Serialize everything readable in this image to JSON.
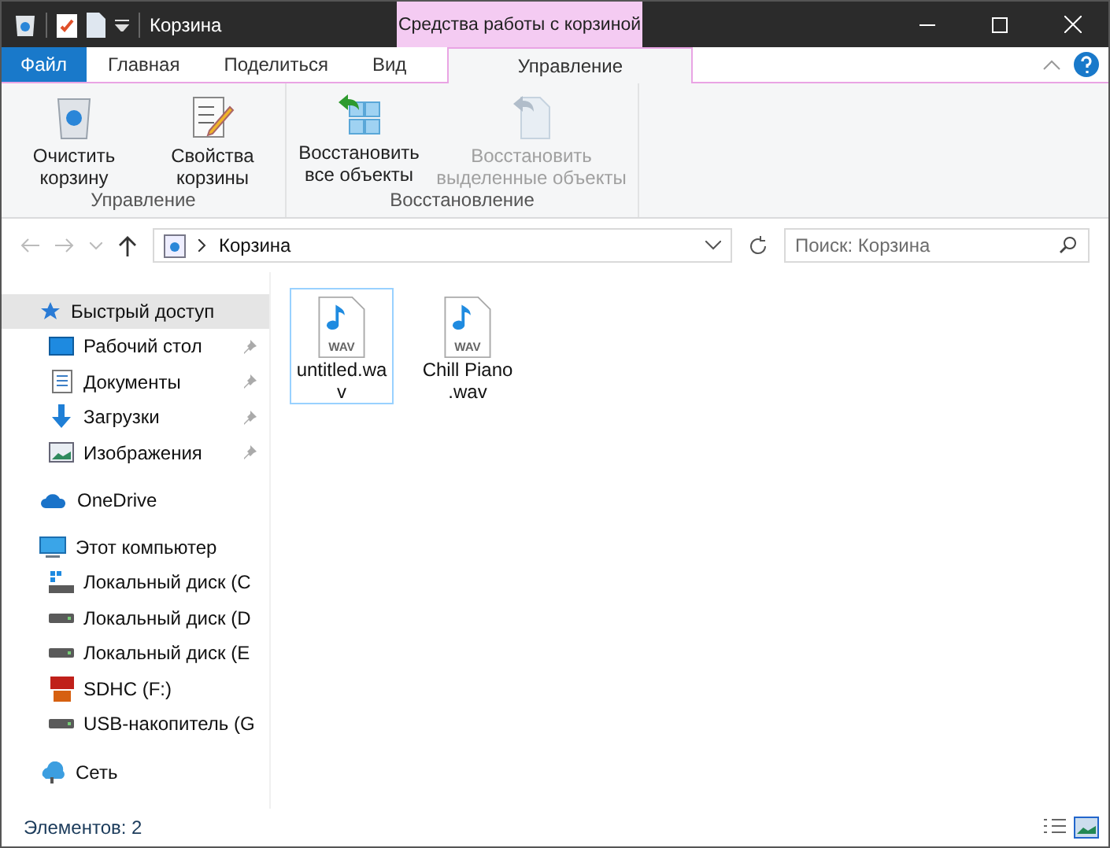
{
  "window": {
    "title": "Корзина",
    "context_group": "Средства работы с корзиной"
  },
  "tabs": [
    {
      "label": "Файл",
      "selected": false,
      "kind": "file"
    },
    {
      "label": "Главная",
      "selected": false,
      "kind": "normal"
    },
    {
      "label": "Поделиться",
      "selected": false,
      "kind": "normal"
    },
    {
      "label": "Вид",
      "selected": false,
      "kind": "normal"
    },
    {
      "label": "Управление",
      "selected": true,
      "kind": "context"
    }
  ],
  "ribbon": {
    "groups": [
      {
        "label": "Управление",
        "buttons": [
          {
            "label": "Очистить корзину",
            "disabled": false
          },
          {
            "label": "Свойства корзины",
            "disabled": false
          }
        ]
      },
      {
        "label": "Восстановление",
        "buttons": [
          {
            "label": "Восстановить все объекты",
            "disabled": false
          },
          {
            "label": "Восстановить выделенные объекты",
            "disabled": true
          }
        ]
      }
    ]
  },
  "address": {
    "path": "Корзина",
    "search_placeholder": "Поиск: Корзина"
  },
  "sidebar": {
    "items": [
      {
        "label": "Быстрый доступ",
        "selected": true,
        "children": [
          {
            "label": "Рабочий стол",
            "pinned": true
          },
          {
            "label": "Документы",
            "pinned": true
          },
          {
            "label": "Загрузки",
            "pinned": true
          },
          {
            "label": "Изображения",
            "pinned": true
          }
        ]
      },
      {
        "label": "OneDrive",
        "selected": false
      },
      {
        "label": "Этот компьютер",
        "selected": false,
        "children": [
          {
            "label": "Локальный диск (C",
            "pinned": false
          },
          {
            "label": "Локальный диск (D",
            "pinned": false
          },
          {
            "label": "Локальный диск (E",
            "pinned": false
          },
          {
            "label": "SDHC (F:)",
            "pinned": false
          },
          {
            "label": "USB-накопитель (G",
            "pinned": false
          }
        ]
      },
      {
        "label": "Сеть",
        "selected": false
      }
    ]
  },
  "files": [
    {
      "name": "untitled.wa v",
      "badge": "WAV",
      "selected": true
    },
    {
      "name": "Chill Piano .wav",
      "badge": "WAV",
      "selected": false
    }
  ],
  "status_bar": {
    "count": "Элементов: 2"
  }
}
